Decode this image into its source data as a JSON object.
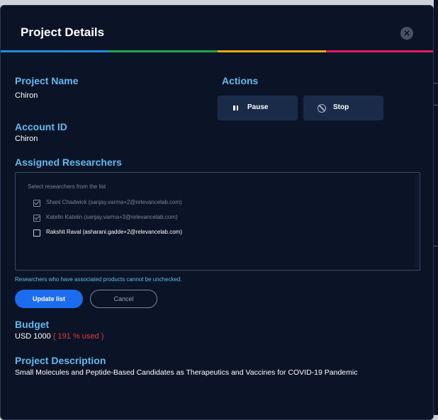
{
  "dialog": {
    "title": "Project Details",
    "close_icon": "close-icon",
    "close_glyph": "✕"
  },
  "accent_colors": [
    "#1f8ce0",
    "#21a84a",
    "#e8a917",
    "#e21c5c"
  ],
  "project_name": {
    "label": "Project Name",
    "value": "Chiron"
  },
  "account_id": {
    "label": "Account ID",
    "value": "Chiron"
  },
  "actions": {
    "label": "Actions",
    "pause": {
      "label": "Pause",
      "icon": "pause-icon"
    },
    "stop": {
      "label": "Stop",
      "icon": "stop-icon"
    }
  },
  "researchers": {
    "label": "Assigned Researchers",
    "hint": "Select researchers from the list",
    "items": [
      {
        "label": "Shani Chadwick (sanjay.varma+2@relevancelab.com)",
        "checked": true,
        "disabled": true
      },
      {
        "label": "Katelin Katelin (sanjay.varma+3@relevancelab.com)",
        "checked": true,
        "disabled": true
      },
      {
        "label": "Rakshit Raval (asharani.gadde+2@relevancelab.com)",
        "checked": false,
        "disabled": false
      }
    ],
    "note": "Researchers who have associated products cannot be unchecked.",
    "update_label": "Update list",
    "cancel_label": "Cancel"
  },
  "budget": {
    "label": "Budget",
    "amount": "USD 1000",
    "used": "( 191 % used )",
    "used_color": "#e03a3a"
  },
  "description": {
    "label": "Project Description",
    "text": "Small Molecules and Peptide-Based Candidates as Therapeutics and Vaccines for COVID-19 Pandemic"
  }
}
